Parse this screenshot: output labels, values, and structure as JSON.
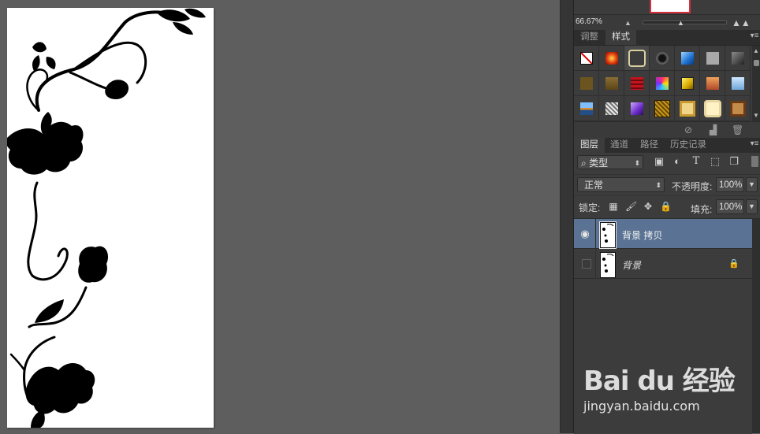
{
  "navigator": {
    "zoom": "66.67%"
  },
  "styles_panel": {
    "tabs": [
      {
        "label": "调整",
        "active": false
      },
      {
        "label": "样式",
        "active": true
      }
    ],
    "swatches": [
      "no-style",
      "red-glow",
      "frame-selected",
      "black-ring",
      "blue-gloss",
      "gray-flat",
      "dark-gradient",
      "brown-flat",
      "brown-texture",
      "red-stripe",
      "multi-color",
      "yellow-gradient",
      "orange-gradient",
      "sky-blue",
      "landscape",
      "crystal",
      "purple-gradient",
      "gold-texture",
      "gold-frame",
      "cream-frame",
      "wood-frame"
    ]
  },
  "layers_panel": {
    "tabs": [
      {
        "label": "图层",
        "active": true
      },
      {
        "label": "通道",
        "active": false
      },
      {
        "label": "路径",
        "active": false
      },
      {
        "label": "历史记录",
        "active": false
      }
    ],
    "filter_kind": "类型",
    "blend_mode": "正常",
    "opacity_label": "不透明度:",
    "opacity_value": "100%",
    "lock_label": "锁定:",
    "fill_label": "填充:",
    "fill_value": "100%",
    "layers": [
      {
        "name": "背景 拷贝",
        "visible": true,
        "selected": true,
        "locked": false,
        "italic": false
      },
      {
        "name": "背景",
        "visible": false,
        "selected": false,
        "locked": true,
        "italic": true
      }
    ]
  },
  "watermark": {
    "logo": "Bai du 经验",
    "url": "jingyan.baidu.com"
  },
  "colors": {
    "canvas_bg": "#5e5e5e",
    "panel_bg": "#3c3c3c",
    "selected_layer": "#5a7394",
    "navigator_frame": "#d62f3e"
  }
}
